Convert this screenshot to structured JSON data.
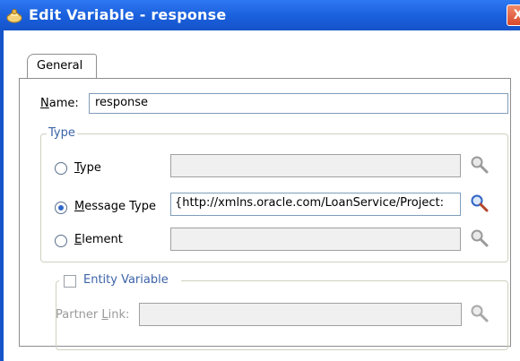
{
  "window": {
    "title": "Edit Variable - response",
    "close_label": "X"
  },
  "tabs": [
    {
      "label": "General"
    }
  ],
  "name": {
    "label": "Name:",
    "value": "response"
  },
  "type_group": {
    "legend": "Type",
    "options": [
      {
        "label": "Type",
        "selected": false,
        "value": ""
      },
      {
        "label": "Message Type",
        "selected": true,
        "value": "{http://xmlns.oracle.com/LoanService/Project:"
      },
      {
        "label": "Element",
        "selected": false,
        "value": ""
      }
    ]
  },
  "entity_group": {
    "checkbox_label": "Entity Variable",
    "checked": false,
    "partner_link_label": "Partner Link:",
    "partner_link_value": ""
  },
  "icons": {
    "title": "bpel-variable-icon",
    "search": "magnifier-icon"
  },
  "colors": {
    "titlebar": "#1a5fdc",
    "accent": "#3067c9",
    "legend_text": "#3c63a8"
  }
}
